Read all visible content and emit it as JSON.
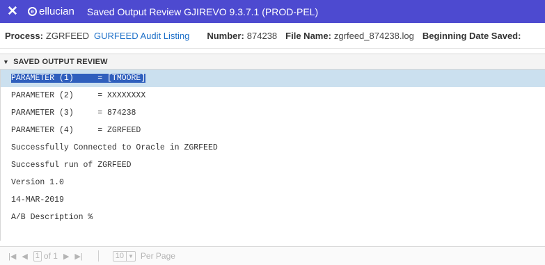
{
  "window": {
    "close_glyph": "✕",
    "brand": "ellucian",
    "title": "Saved Output Review GJIREVO 9.3.7.1 (PROD-PEL)"
  },
  "info": {
    "process_label": "Process:",
    "process_value": "ZGRFEED",
    "process_name": "GURFEED Audit Listing",
    "number_label": "Number:",
    "number_value": "874238",
    "file_label": "File Name:",
    "file_value": "zgrfeed_874238.log",
    "begin_label": "Beginning Date Saved:"
  },
  "section": {
    "title": "SAVED OUTPUT REVIEW"
  },
  "output_lines": [
    "PARAMETER (1)     = [TMOORE]",
    "PARAMETER (2)     = XXXXXXXX",
    "PARAMETER (3)     = 874238",
    "PARAMETER (4)     = ZGRFEED",
    "Successfully Connected to Oracle in ZGRFEED",
    "Successful run of ZGRFEED",
    "Version 1.0",
    "14-MAR-2019",
    "A/B Description %"
  ],
  "pager": {
    "first_icon": "first-page-icon",
    "prev_icon": "prev-page-icon",
    "next_icon": "next-page-icon",
    "last_icon": "last-page-icon",
    "page": "1",
    "of_text": "of 1",
    "per_page_value": "10",
    "per_page_label": "Per Page"
  },
  "colors": {
    "topbar": "#4d4ad0",
    "link": "#1e70c8",
    "selected_row": "#cbe0ef",
    "selected_text_bg": "#2f5fbd"
  }
}
